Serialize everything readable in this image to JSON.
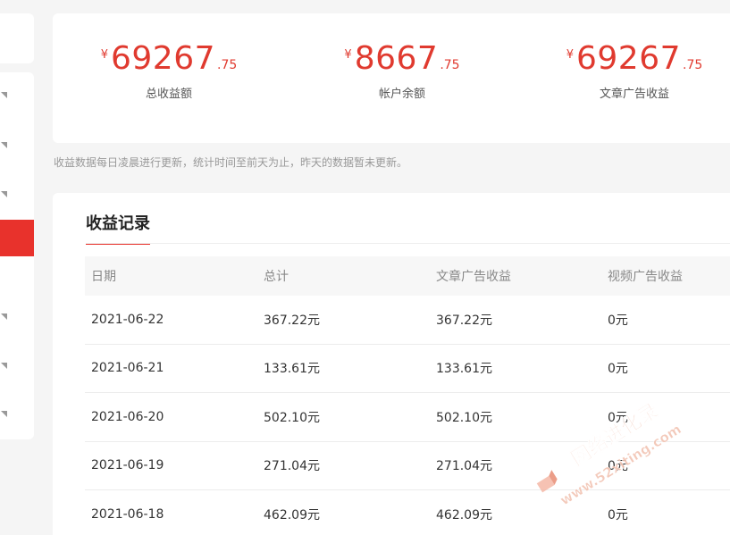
{
  "stats": [
    {
      "currency": "¥",
      "integer": "69267",
      "decimal": ".75",
      "label": "总收益额"
    },
    {
      "currency": "¥",
      "integer": "8667",
      "decimal": ".75",
      "label": "帐户余额"
    },
    {
      "currency": "¥",
      "integer": "69267",
      "decimal": ".75",
      "label": "文章广告收益"
    }
  ],
  "note": "收益数据每日凌晨进行更新，统计时间至前天为止，昨天的数据暂未更新。",
  "records": {
    "title": "收益记录",
    "headers": [
      "日期",
      "总计",
      "文章广告收益",
      "视频广告收益"
    ],
    "rows": [
      [
        "2021-06-22",
        "367.22元",
        "367.22元",
        "0元"
      ],
      [
        "2021-06-21",
        "133.61元",
        "133.61元",
        "0元"
      ],
      [
        "2021-06-20",
        "502.10元",
        "502.10元",
        "0元"
      ],
      [
        "2021-06-19",
        "271.04元",
        "271.04元",
        "0元"
      ],
      [
        "2021-06-18",
        "462.09元",
        "462.09元",
        "0元"
      ]
    ]
  },
  "watermark": {
    "line1": "网络进化录",
    "line2": "www.52xiting.com"
  },
  "colors": {
    "accent": "#e8322c",
    "value_red": "#e03a2f"
  }
}
